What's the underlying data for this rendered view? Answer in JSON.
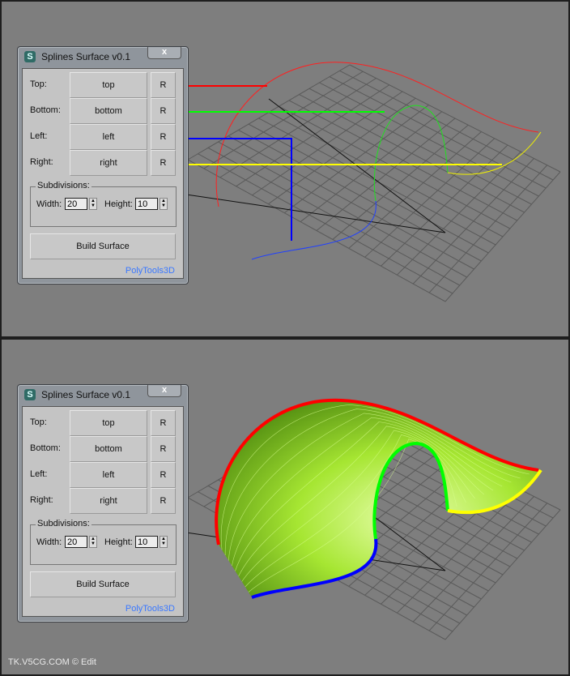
{
  "dialog": {
    "title": "Splines Surface v0.1",
    "close_label": "x",
    "app_icon": "3ds-max-icon",
    "rows": [
      {
        "label": "Top:",
        "button": "top",
        "pick": "R",
        "color": "#ff0000"
      },
      {
        "label": "Bottom:",
        "button": "bottom",
        "pick": "R",
        "color": "#00ff00"
      },
      {
        "label": "Left:",
        "button": "left",
        "pick": "R",
        "color": "#0000ff"
      },
      {
        "label": "Right:",
        "button": "right",
        "pick": "R",
        "color": "#ffff00"
      }
    ],
    "subdivisions": {
      "legend": "Subdivisions:",
      "width_label": "Width:",
      "width_value": "20",
      "height_label": "Height:",
      "height_value": "10"
    },
    "build_label": "Build Surface",
    "brand": "PolyTools3D"
  },
  "footer": "TK.V5CG.COM © Edit",
  "colors": {
    "viewport": "#7e7e7e",
    "surface": "#9be22a"
  }
}
